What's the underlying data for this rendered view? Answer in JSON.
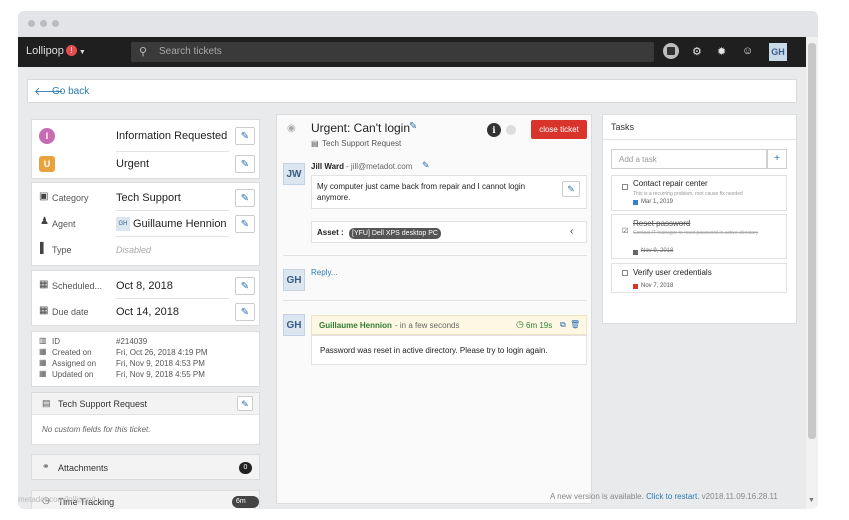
{
  "app": {
    "brand": "Lollipop",
    "brand_badge": "!",
    "search_placeholder": "Search tickets",
    "avatar": "GH"
  },
  "nav_icons": [
    "ticket-icon",
    "sitemap-icon",
    "gear-icon",
    "smile-icon"
  ],
  "goback": {
    "label": "Go back"
  },
  "status_rows": [
    {
      "letter": "I",
      "value": "Information Requested",
      "color": "#c76bb3"
    },
    {
      "letter": "U",
      "value": "Urgent",
      "color": "#e8a33d"
    }
  ],
  "properties": {
    "category": {
      "label": "Category",
      "value": "Tech Support"
    },
    "agent": {
      "label": "Agent",
      "initials": "GH",
      "value": "Guillaume Hennion"
    },
    "type": {
      "label": "Type",
      "value": "Disabled"
    }
  },
  "dates": {
    "scheduled": {
      "label": "Scheduled...",
      "value": "Oct 8, 2018"
    },
    "due": {
      "label": "Due date",
      "value": "Oct 14, 2018"
    }
  },
  "meta": {
    "id": {
      "label": "ID",
      "value": "#214039"
    },
    "created": {
      "label": "Created on",
      "value": "Fri, Oct 26, 2018 4:19 PM"
    },
    "assigned": {
      "label": "Assigned on",
      "value": "Fri, Nov 9, 2018 4:53 PM"
    },
    "updated": {
      "label": "Updated on",
      "value": "Fri, Nov 9, 2018 4:55 PM"
    }
  },
  "custom_fields": {
    "title": "Tech Support Request",
    "empty": "No custom fields for this ticket."
  },
  "attachments": {
    "label": "Attachments",
    "count": "0"
  },
  "time_tracking": {
    "label": "Time Tracking",
    "value": "6m 19s"
  },
  "status_url": "metadot.com/lollipop/t...",
  "ticket": {
    "title": "Urgent: Can't login",
    "subtitle": "Tech Support Request",
    "close_label": "close ticket"
  },
  "message": {
    "initials": "JW",
    "author": "Jill Ward",
    "email": " - jill@metadot.com",
    "body": "My computer just came back from repair and I cannot login anymore.",
    "asset_label": "Asset :",
    "asset_value": "[YFU] Dell XPS desktop PC"
  },
  "reply": {
    "initials": "GH",
    "placeholder": "Reply..."
  },
  "response": {
    "initials": "GH",
    "author": "Guillaume Hennion",
    "when": " - in a few seconds",
    "timer": "6m 19s",
    "body": "Password was reset in active directory. Please try to login again."
  },
  "tasks": {
    "title": "Tasks",
    "add_placeholder": "Add a task",
    "add_button": "+",
    "items": [
      {
        "title": "Contact repair center",
        "note": "This is a recurring problem, root cause fix needed",
        "date": "Mar 1, 2019",
        "done": false,
        "color": "#3a7bd5"
      },
      {
        "title": "Reset password",
        "note": "Contact IT manager to reset password in active directory",
        "date": "Nov 9, 2018",
        "done": true,
        "color": "#666666"
      },
      {
        "title": "Verify user credentials",
        "note": "",
        "date": "Nov 7, 2018",
        "done": false,
        "color": "#d9342b"
      }
    ]
  },
  "footer": {
    "text": "A new version is available.",
    "link": "Click to restart.",
    "version": "v2018.11.09.16.28.11"
  }
}
